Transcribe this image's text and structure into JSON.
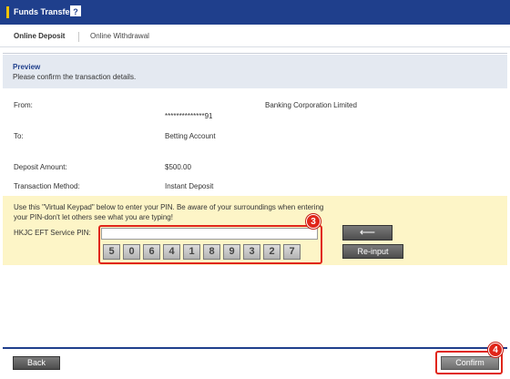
{
  "header": {
    "title": "Funds Transfer",
    "help_icon": "?"
  },
  "tabs": [
    {
      "label": "Online Deposit",
      "active": true
    },
    {
      "label": "Online Withdrawal",
      "active": false
    }
  ],
  "preview": {
    "heading": "Preview",
    "subtitle": "Please confirm the transaction details."
  },
  "details": {
    "from_label": "From:",
    "from_bank": "Banking Corporation Limited",
    "from_account": "**************91",
    "to_label": "To:",
    "to_value": "Betting Account",
    "amount_label": "Deposit Amount:",
    "amount_value": "$500.00",
    "method_label": "Transaction Method:",
    "method_value": "Instant Deposit"
  },
  "keypad": {
    "note_line1": "Use this \"Virtual Keypad\" below to enter your PIN. Be aware of your surroundings when entering",
    "note_line2": "your PIN-don't let others see what you are typing!",
    "pin_label": "HKJC EFT Service PIN:",
    "pin_value": "",
    "keys": [
      "5",
      "0",
      "6",
      "4",
      "1",
      "8",
      "9",
      "3",
      "2",
      "7"
    ],
    "backspace_label": "⟵",
    "reinput_label": "Re-input"
  },
  "footer": {
    "back_label": "Back",
    "confirm_label": "Confirm"
  },
  "annotations": {
    "step3": "3",
    "step4": "4"
  },
  "colors": {
    "brand_blue": "#1f3f8c",
    "highlight_red": "#e0261a",
    "keypad_bg": "#fdf5c7",
    "preview_bg": "#e4e9f1"
  }
}
